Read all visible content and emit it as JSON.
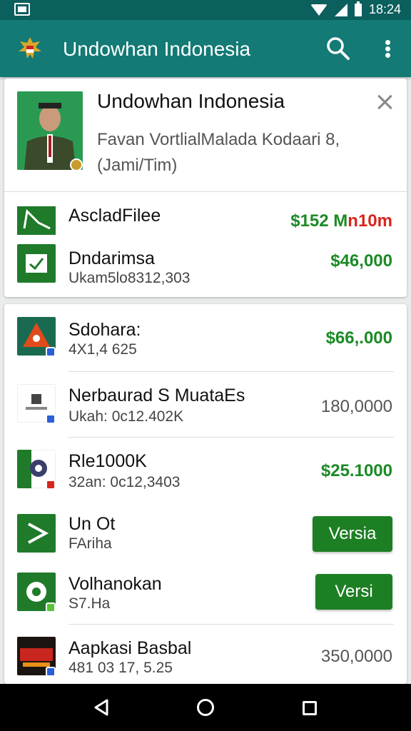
{
  "status_bar": {
    "time": "18:24"
  },
  "app_bar": {
    "title": "Undowhan Indonesia"
  },
  "profile": {
    "name": "Undowhan Indonesia",
    "description": "Favan VortlialMalada Kodaari 8, (Jami/Tim)"
  },
  "summary": [
    {
      "title": "AscladFilee",
      "value": "$152 M",
      "value_suffix": "n10m"
    },
    {
      "title": "Dndarimsa",
      "subtitle": "Ukam5lo8312,303",
      "value": "$46,000"
    }
  ],
  "list": [
    {
      "title": "Sdohara:",
      "subtitle": "4X1,4 625",
      "value": "$66,.000"
    },
    {
      "title": "Nerbaurad S MuataEs",
      "subtitle": "Ukah: 0c12.402K",
      "value": "180,0000"
    },
    {
      "title": "Rle1000K",
      "subtitle": "32an: 0c12,3403",
      "value": "$25.1000"
    },
    {
      "title": "Un Ot",
      "subtitle": "FAriha",
      "button": "Versia"
    },
    {
      "title": "Volhanokan",
      "subtitle": "S7.Ha",
      "button": "Versi"
    },
    {
      "title": "Aapkasi Basbal",
      "subtitle": "481 03 17, 5.25",
      "value": "350,0000"
    }
  ],
  "colors": {
    "primary": "#137a75",
    "status_bar": "#0b5f5d",
    "positive": "#1b8a25",
    "negative": "#d6261e"
  }
}
